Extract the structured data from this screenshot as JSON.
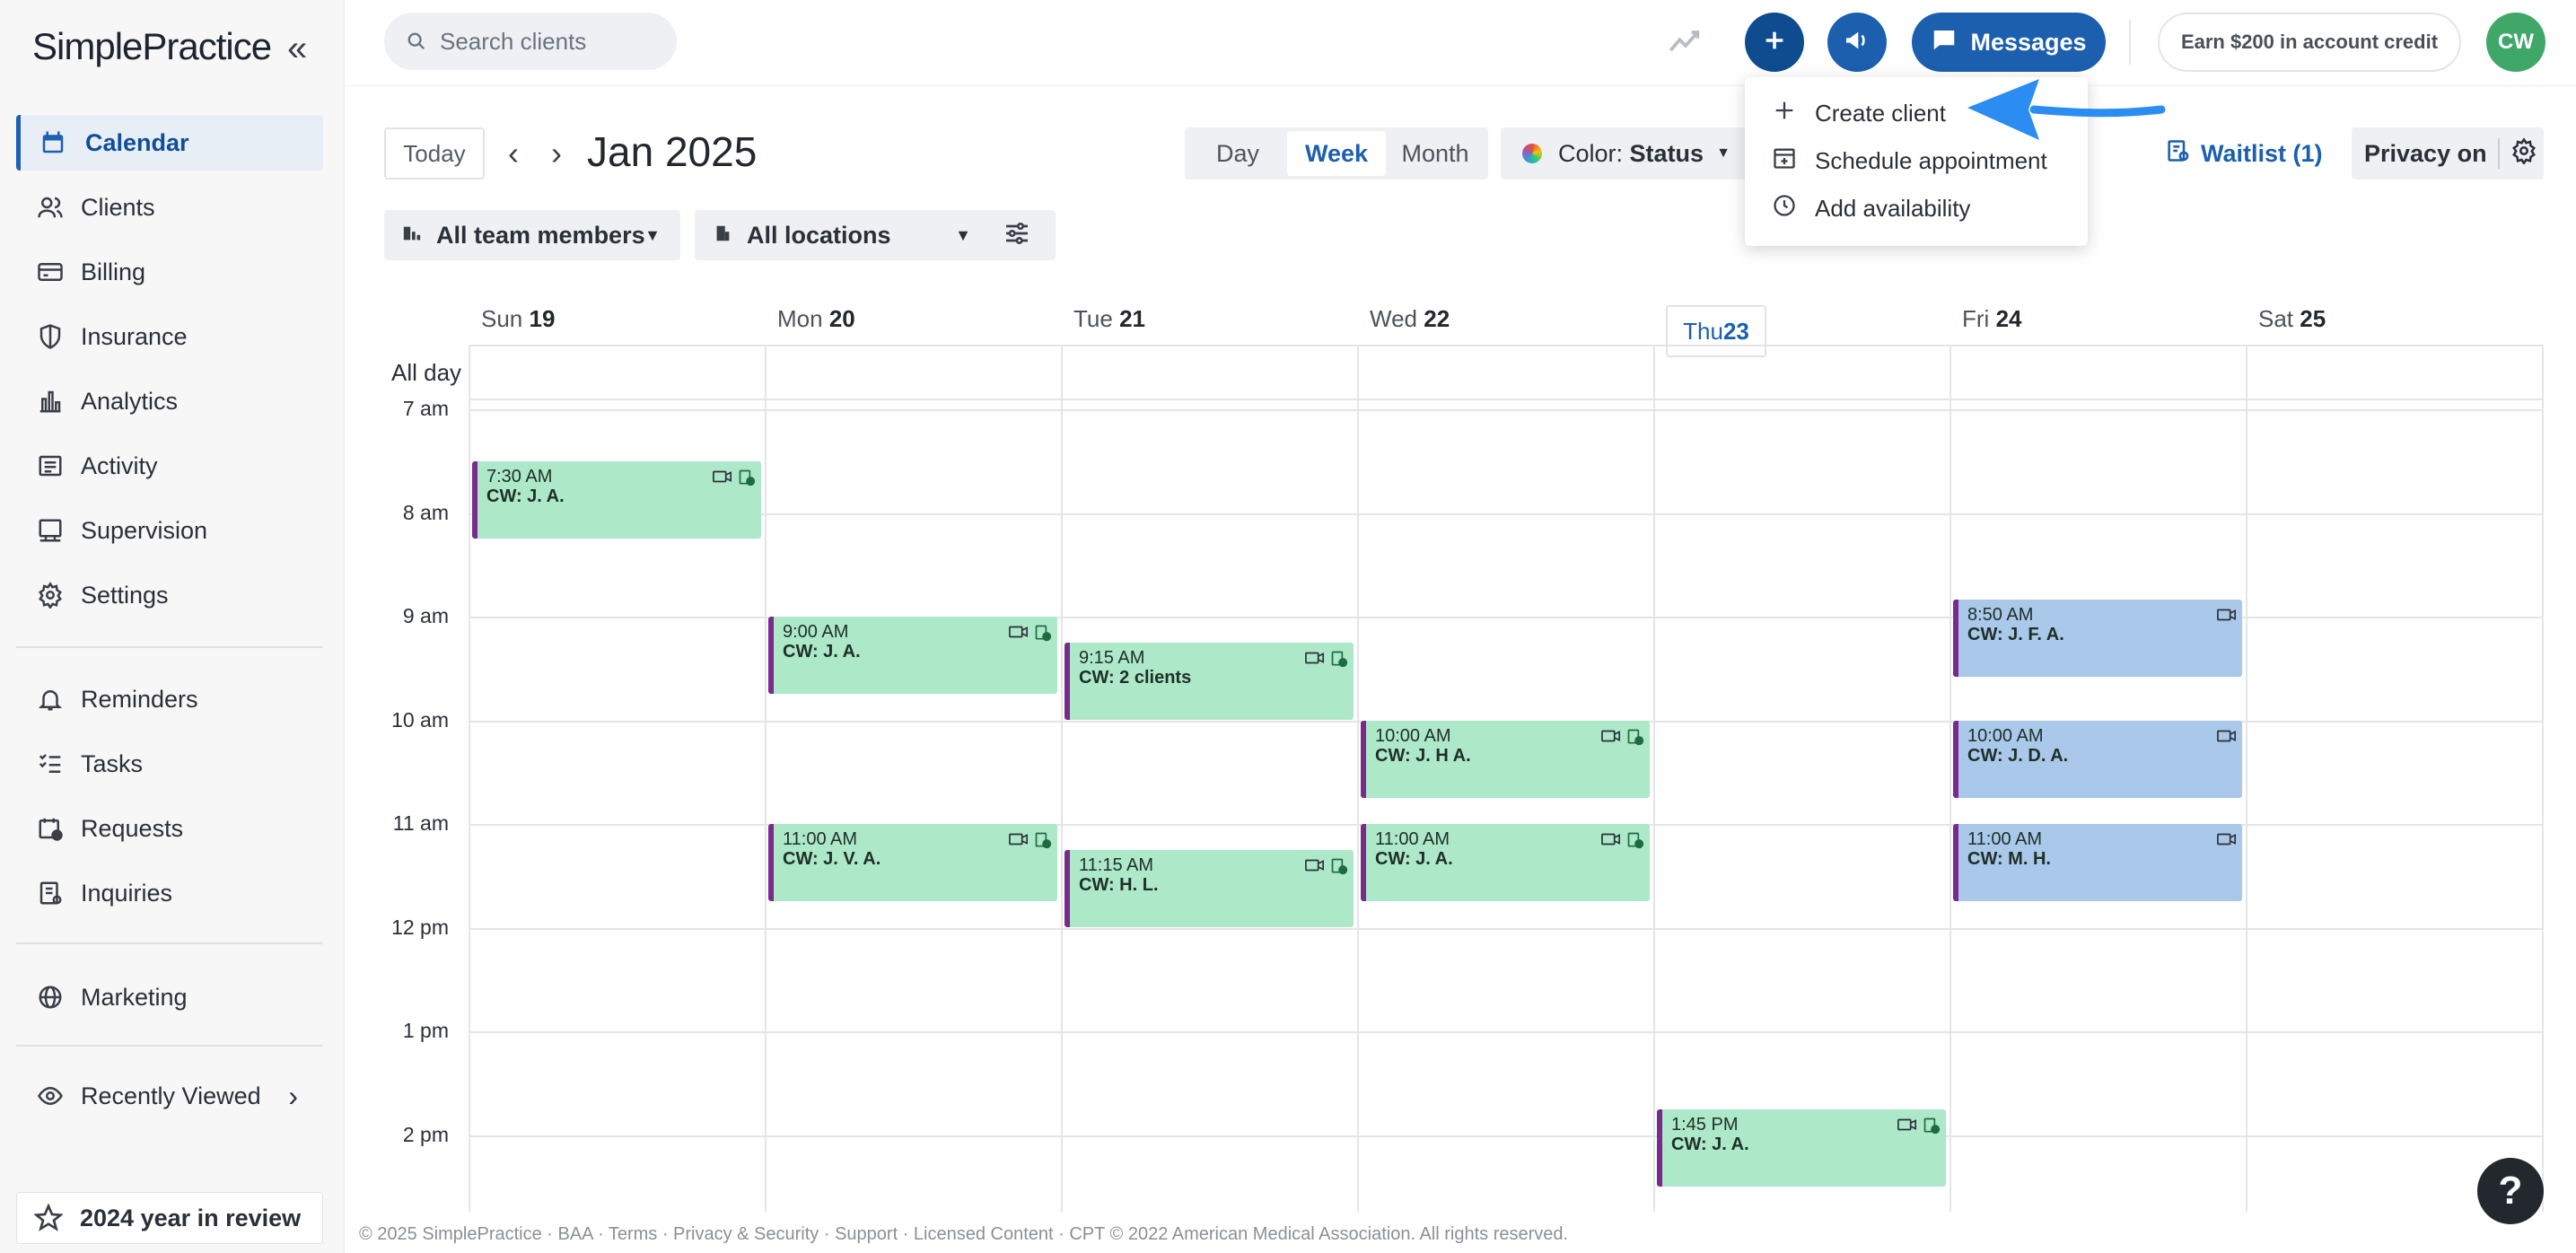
{
  "brand": {
    "logo_text": "SimplePractice",
    "accent": "#1b5fae",
    "appt_green": "#ade8c9",
    "appt_blue": "#a9c8ea",
    "status_bar": "#7a2a8c"
  },
  "sidebar": {
    "items": [
      {
        "label": "Calendar",
        "icon": "calendar-icon"
      },
      {
        "label": "Clients",
        "icon": "clients-icon"
      },
      {
        "label": "Billing",
        "icon": "billing-icon"
      },
      {
        "label": "Insurance",
        "icon": "shield-icon"
      },
      {
        "label": "Analytics",
        "icon": "analytics-icon"
      },
      {
        "label": "Activity",
        "icon": "activity-icon"
      },
      {
        "label": "Supervision",
        "icon": "supervision-icon"
      },
      {
        "label": "Settings",
        "icon": "gear-icon"
      },
      {
        "label": "Reminders",
        "icon": "bell-icon"
      },
      {
        "label": "Tasks",
        "icon": "tasks-icon"
      },
      {
        "label": "Requests",
        "icon": "requests-icon"
      },
      {
        "label": "Inquiries",
        "icon": "inquiries-icon"
      },
      {
        "label": "Marketing",
        "icon": "globe-icon"
      },
      {
        "label": "Recently Viewed",
        "icon": "eye-icon"
      }
    ],
    "year_review": "2024 year in review"
  },
  "header": {
    "search_placeholder": "Search clients",
    "messages_label": "Messages",
    "earn_label": "Earn $200 in account credit",
    "avatar_initials": "CW"
  },
  "toolbar": {
    "today_label": "Today",
    "month_title": "Jan 2025",
    "views": [
      "Day",
      "Week",
      "Month"
    ],
    "selected_view": "Week",
    "color_label": "Color:",
    "color_value": "Status",
    "waitlist_label": "Waitlist (1)",
    "privacy_label": "Privacy on"
  },
  "filters": {
    "team": "All team members",
    "locations": "All locations"
  },
  "add_menu": {
    "items": [
      {
        "label": "Create client",
        "icon": "plus-icon"
      },
      {
        "label": "Schedule appointment",
        "icon": "calendar-add-icon"
      },
      {
        "label": "Add availability",
        "icon": "clock-icon"
      }
    ]
  },
  "calendar": {
    "all_day_label": "All day",
    "days": [
      {
        "name": "Sun",
        "num": "19"
      },
      {
        "name": "Mon",
        "num": "20"
      },
      {
        "name": "Tue",
        "num": "21"
      },
      {
        "name": "Wed",
        "num": "22"
      },
      {
        "name": "Thu",
        "num": "23",
        "today": true
      },
      {
        "name": "Fri",
        "num": "24"
      },
      {
        "name": "Sat",
        "num": "25"
      }
    ],
    "hours": [
      "7 am",
      "8 am",
      "9 am",
      "10 am",
      "11 am",
      "12 pm",
      "1 pm",
      "2 pm"
    ],
    "appointments": [
      {
        "day": 0,
        "time": "7:30 AM",
        "client": "CW: J. A.",
        "start_hour": 7.5,
        "color": "green",
        "video": true,
        "doc": true
      },
      {
        "day": 1,
        "time": "9:00 AM",
        "client": "CW: J. A.",
        "start_hour": 9.0,
        "color": "green",
        "video": true,
        "doc": true
      },
      {
        "day": 1,
        "time": "11:00 AM",
        "client": "CW: J. V. A.",
        "start_hour": 11.0,
        "color": "green",
        "video": true,
        "doc": true
      },
      {
        "day": 2,
        "time": "9:15 AM",
        "client": "CW: 2 clients",
        "start_hour": 9.25,
        "color": "green",
        "video": true,
        "doc": true
      },
      {
        "day": 2,
        "time": "11:15 AM",
        "client": "CW: H. L.",
        "start_hour": 11.25,
        "color": "green",
        "video": true,
        "doc": true
      },
      {
        "day": 3,
        "time": "10:00 AM",
        "client": "CW: J. H A.",
        "start_hour": 10.0,
        "color": "green",
        "video": true,
        "doc": true
      },
      {
        "day": 3,
        "time": "11:00 AM",
        "client": "CW: J. A.",
        "start_hour": 11.0,
        "color": "green",
        "video": true,
        "doc": true
      },
      {
        "day": 4,
        "time": "1:45 PM",
        "client": "CW: J. A.",
        "start_hour": 13.75,
        "color": "green",
        "video": true,
        "doc": true
      },
      {
        "day": 5,
        "time": "8:50 AM",
        "client": "CW: J. F. A.",
        "start_hour": 8.833,
        "color": "blue",
        "video": true,
        "doc": false
      },
      {
        "day": 5,
        "time": "10:00 AM",
        "client": "CW: J. D. A.",
        "start_hour": 10.0,
        "color": "blue",
        "video": true,
        "doc": false
      },
      {
        "day": 5,
        "time": "11:00 AM",
        "client": "CW: M. H.",
        "start_hour": 11.0,
        "color": "blue",
        "video": true,
        "doc": false
      }
    ]
  },
  "footer": "© 2025 SimplePractice · BAA · Terms · Privacy & Security · Support · Licensed Content · CPT © 2022 American Medical Association. All rights reserved."
}
